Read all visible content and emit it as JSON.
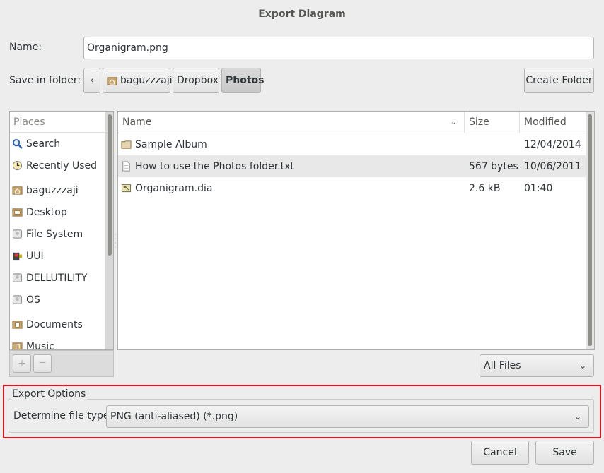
{
  "window": {
    "title": "Export Diagram"
  },
  "name_row": {
    "label": "Name:",
    "value": "Organigram.png"
  },
  "folder_row": {
    "label": "Save in folder:",
    "breadcrumbs": [
      "baguzzzaji",
      "Dropbox",
      "Photos"
    ],
    "create_folder": "Create Folder"
  },
  "places": {
    "header": "Places",
    "items": [
      {
        "label": "Search",
        "icon": "search-icon"
      },
      {
        "label": "Recently Used",
        "icon": "clock-icon"
      },
      {
        "label": "baguzzzaji",
        "icon": "home-folder-icon"
      },
      {
        "label": "Desktop",
        "icon": "desktop-folder-icon"
      },
      {
        "label": "File System",
        "icon": "drive-icon"
      },
      {
        "label": "UUI",
        "icon": "usb-drive-icon"
      },
      {
        "label": "DELLUTILITY",
        "icon": "drive-icon"
      },
      {
        "label": "OS",
        "icon": "drive-icon"
      },
      {
        "label": "Documents",
        "icon": "documents-folder-icon"
      },
      {
        "label": "Music",
        "icon": "music-folder-icon"
      }
    ],
    "add_symbol": "+",
    "remove_symbol": "—"
  },
  "files": {
    "columns": {
      "name": "Name",
      "size": "Size",
      "modified": "Modified"
    },
    "rows": [
      {
        "name": "Sample Album",
        "size": "",
        "modified": "12/04/2014",
        "icon": "folder-icon"
      },
      {
        "name": "How to use the Photos folder.txt",
        "size": "567 bytes",
        "modified": "10/06/2011",
        "icon": "text-file-icon"
      },
      {
        "name": "Organigram.dia",
        "size": "2.6 kB",
        "modified": "01:40",
        "icon": "dia-file-icon"
      }
    ]
  },
  "filter": {
    "value": "All Files"
  },
  "export_options": {
    "legend": "Export Options",
    "file_type_label": "Determine file type:",
    "file_type_value": "PNG (anti-aliased) (*.png)"
  },
  "buttons": {
    "cancel": "Cancel",
    "save": "Save"
  },
  "colors": {
    "highlight_border": "#e5141c",
    "folder": "#c9a76b"
  }
}
